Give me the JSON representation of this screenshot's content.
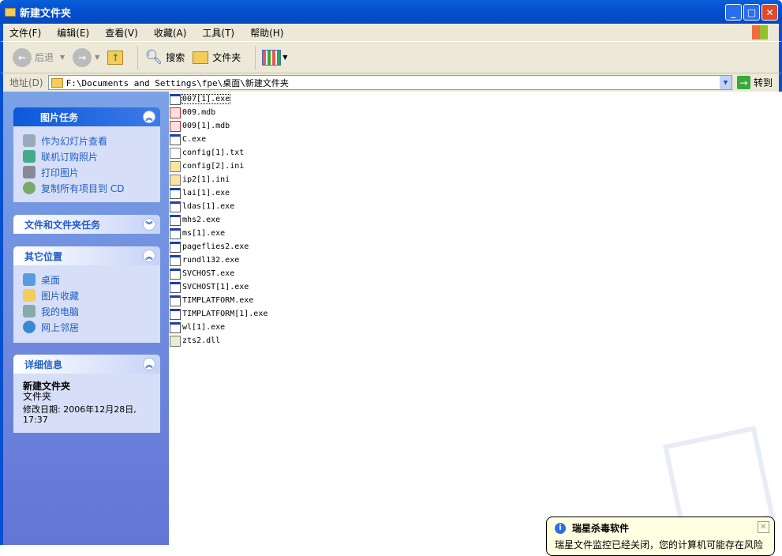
{
  "window": {
    "title": "新建文件夹"
  },
  "menu": [
    "文件(F)",
    "编辑(E)",
    "查看(V)",
    "收藏(A)",
    "工具(T)",
    "帮助(H)"
  ],
  "toolbar": {
    "back": "后退",
    "search": "搜索",
    "folders": "文件夹"
  },
  "address": {
    "label": "地址(D)",
    "value": "F:\\Documents and Settings\\fpe\\桌面\\新建文件夹",
    "go": "转到"
  },
  "panels": {
    "picture_tasks": {
      "title": "图片任务",
      "items": [
        "作为幻灯片查看",
        "联机订购照片",
        "打印图片",
        "复制所有项目到 CD"
      ]
    },
    "file_tasks": {
      "title": "文件和文件夹任务"
    },
    "other_places": {
      "title": "其它位置",
      "items": [
        "桌面",
        "图片收藏",
        "我的电脑",
        "网上邻居"
      ]
    },
    "details": {
      "title": "详细信息",
      "name": "新建文件夹",
      "type": "文件夹",
      "modified": "修改日期: 2006年12月28日, 17:37"
    }
  },
  "files": [
    {
      "name": "007[1].exe",
      "type": "exe"
    },
    {
      "name": "009.mdb",
      "type": "mdb"
    },
    {
      "name": "009[1].mdb",
      "type": "mdb"
    },
    {
      "name": "C.exe",
      "type": "exe"
    },
    {
      "name": "config[1].txt",
      "type": "txt"
    },
    {
      "name": "config[2].ini",
      "type": "ini"
    },
    {
      "name": "ip2[1].ini",
      "type": "ini"
    },
    {
      "name": "lai[1].exe",
      "type": "exe"
    },
    {
      "name": "ldas[1].exe",
      "type": "exe"
    },
    {
      "name": "mhs2.exe",
      "type": "exe"
    },
    {
      "name": "ms[1].exe",
      "type": "exe"
    },
    {
      "name": "pageflies2.exe",
      "type": "exe"
    },
    {
      "name": "rundl132.exe",
      "type": "exe"
    },
    {
      "name": "SVCHOST.exe",
      "type": "exe"
    },
    {
      "name": "SVCHOST[1].exe",
      "type": "exe"
    },
    {
      "name": "TIMPLATFORM.exe",
      "type": "exe"
    },
    {
      "name": "TIMPLATFORM[1].exe",
      "type": "exe"
    },
    {
      "name": "wl[1].exe",
      "type": "exe"
    },
    {
      "name": "zts2.dll",
      "type": "dll"
    }
  ],
  "balloon": {
    "title": "瑞星杀毒软件",
    "message": "瑞星文件监控已经关闭，您的计算机可能存在风险"
  }
}
